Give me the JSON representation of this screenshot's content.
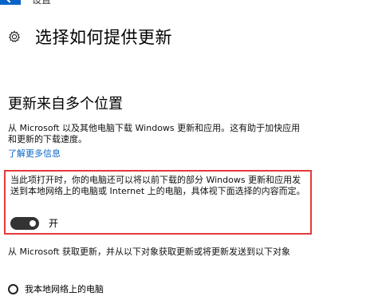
{
  "header": {
    "breadcrumb": "设置",
    "page_title": "选择如何提供更新"
  },
  "section": {
    "title": "更新来自多个位置",
    "description": "从 Microsoft 以及其他电脑下载 Windows 更新和应用。这有助于加快应用和更新的下载速度。",
    "learn_more": "了解更多信息"
  },
  "highlight": {
    "text": "当此项打开时，你的电脑还可以将以前下载的部分 Windows 更新和应用发送到本地网络上的电脑或 Internet 上的电脑，具体视下面选择的内容而定。",
    "toggle_label": "开",
    "toggle_on": true
  },
  "options": {
    "description": "从 Microsoft 获取更新，并从以下对象获取更新或将更新发送到以下对象",
    "radio_local": "我本地网络上的电脑"
  },
  "colors": {
    "accent": "#0a64c8",
    "highlight_border": "#e33a3a",
    "toggle_on": "#333333"
  }
}
